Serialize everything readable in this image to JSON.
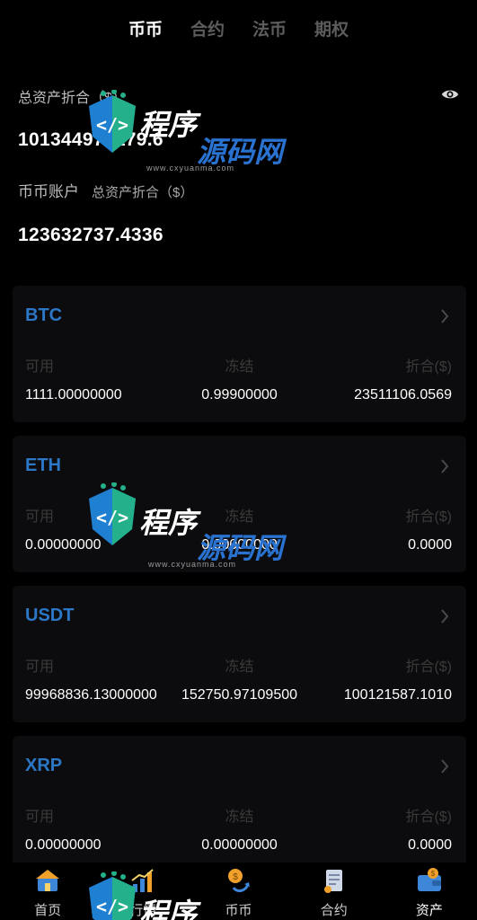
{
  "tabs": [
    {
      "label": "币币",
      "active": true
    },
    {
      "label": "合约",
      "active": false
    },
    {
      "label": "法币",
      "active": false
    },
    {
      "label": "期权",
      "active": false
    }
  ],
  "summary": {
    "total_label": "总资产折合（$）",
    "total_value": "101344979179.6",
    "eye_icon": "eye-icon"
  },
  "account": {
    "name": "币币账户",
    "sub_label": "总资产折合（$）",
    "value": "123632737.4336"
  },
  "columns": {
    "available": "可用",
    "frozen": "冻结",
    "converted": "折合($)"
  },
  "coins": [
    {
      "name": "BTC",
      "available": "1111.00000000",
      "frozen": "0.99900000",
      "converted": "23511106.0569"
    },
    {
      "name": "ETH",
      "available": "0.00000000",
      "frozen": "0.00000000",
      "converted": "0.0000"
    },
    {
      "name": "USDT",
      "available": "99968836.13000000",
      "frozen": "152750.97109500",
      "converted": "100121587.1010"
    },
    {
      "name": "XRP",
      "available": "0.00000000",
      "frozen": "0.00000000",
      "converted": "0.0000"
    }
  ],
  "nav": [
    {
      "label": "首页",
      "icon": "home-icon",
      "active": false
    },
    {
      "label": "行情",
      "icon": "chart-icon",
      "active": false
    },
    {
      "label": "币币",
      "icon": "coin-exchange-icon",
      "active": false
    },
    {
      "label": "合约",
      "icon": "contract-icon",
      "active": false
    },
    {
      "label": "资产",
      "icon": "wallet-icon",
      "active": true
    }
  ],
  "watermark": {
    "brand_a": "程序",
    "brand_b": "源码网",
    "url": "www.cxyuanma.com"
  },
  "colors": {
    "background": "#000000",
    "card": "#0c0c0e",
    "coin_accent": "#2c77c6",
    "muted": "#3a3a3a"
  }
}
